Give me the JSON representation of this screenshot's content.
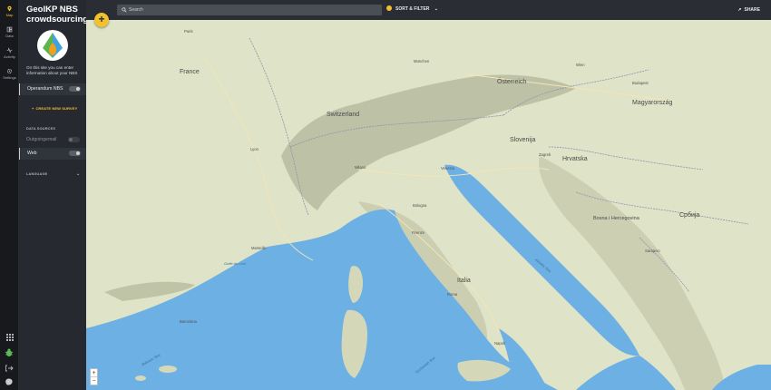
{
  "rail": {
    "items": [
      {
        "label": "Map",
        "icon": "map-pin-icon",
        "active": true
      },
      {
        "label": "Data",
        "icon": "data-icon"
      },
      {
        "label": "Activity",
        "icon": "activity-icon"
      },
      {
        "label": "Settings",
        "icon": "settings-icon"
      }
    ],
    "bottom_icons": [
      "apps-grid-icon",
      "bug-icon",
      "logout-icon",
      "brain-icon"
    ]
  },
  "panel": {
    "title": "GeoIKP NBS crowdsourcing",
    "description": "On this site you can enter information about your NBS",
    "surveys": [
      {
        "label": "Operandum NBS",
        "enabled": true
      }
    ],
    "create_label": "CREATE NEW SURVEY",
    "data_sources_heading": "DATA SOURCES",
    "data_sources": [
      {
        "label": "Outgoingemail",
        "enabled": false
      },
      {
        "label": "Web",
        "enabled": true
      }
    ],
    "language_heading": "LANGUAGE"
  },
  "topbar": {
    "search_placeholder": "Search",
    "sort_label": "SORT & FILTER",
    "share_label": "SHARE"
  },
  "map": {
    "add_button": "+",
    "zoom_in": "+",
    "zoom_out": "−",
    "labels": {
      "france": "France",
      "switzerland": "Switzerland",
      "osterreich": "Österreich",
      "magyarorszag": "Magyarország",
      "italia": "Italia",
      "hrvatska": "Hrvatska",
      "slovenija": "Slovenija",
      "bosna": "Bosna i Hercegovina",
      "srbija": "Србија",
      "paris": "Paris",
      "munchen": "München",
      "wien": "Wien",
      "budapest": "Budapest",
      "milano": "Milano",
      "venezia": "Venezia",
      "bologna": "Bologna",
      "firenze": "Firenze",
      "roma": "Roma",
      "napoli": "Napoli",
      "barcelona": "Barcelona",
      "marseille": "Marseille",
      "lyon": "Lyon",
      "zagreb": "Zagreb",
      "sarajevo": "Sarajevo",
      "adriatic": "Adriatic Sea",
      "tyrrhenian": "Tyrrhenian Sea",
      "balearic": "Balearic Sea",
      "golfe": "Golfe du Lion"
    },
    "colors": {
      "land": "#dfe3c7",
      "water": "#6cb0e4",
      "mountains": "#b7bb9f",
      "border": "#9a8fb0",
      "road": "#f2e7b6"
    }
  }
}
